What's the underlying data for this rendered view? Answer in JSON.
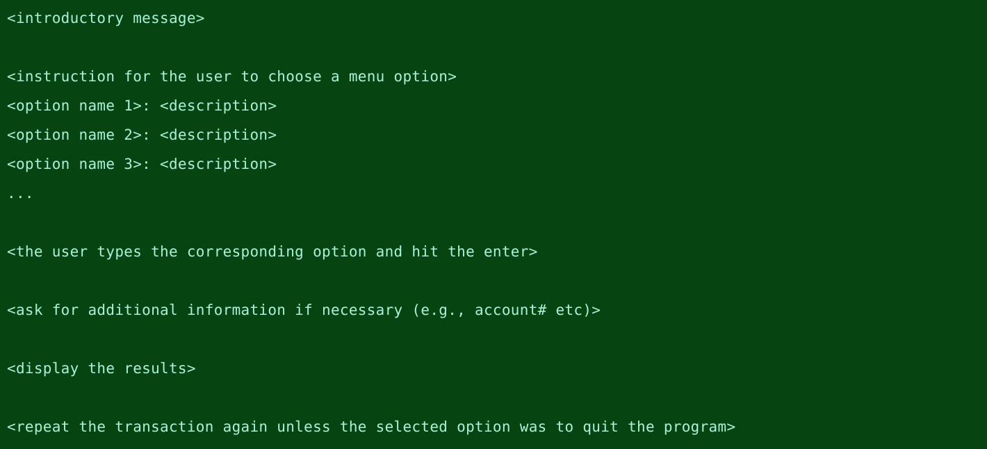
{
  "terminal": {
    "background_color": "#064512",
    "text_color": "#a9f0d6",
    "lines": [
      {
        "id": "intro",
        "text": "<introductory message>",
        "blank": false
      },
      {
        "id": "blank-1",
        "text": "",
        "blank": true
      },
      {
        "id": "menu-instruction",
        "text": "<instruction for the user to choose a menu option>",
        "blank": false
      },
      {
        "id": "option-1",
        "text": "<option name 1>: <description>",
        "blank": false
      },
      {
        "id": "option-2",
        "text": "<option name 2>: <description>",
        "blank": false
      },
      {
        "id": "option-3",
        "text": "<option name 3>: <description>",
        "blank": false
      },
      {
        "id": "ellipsis",
        "text": "...",
        "blank": false
      },
      {
        "id": "blank-2",
        "text": "",
        "blank": true
      },
      {
        "id": "user-input",
        "text": "<the user types the corresponding option and hit the enter>",
        "blank": false
      },
      {
        "id": "blank-3",
        "text": "",
        "blank": true
      },
      {
        "id": "additional-info",
        "text": "<ask for additional information if necessary (e.g., account# etc)>",
        "blank": false
      },
      {
        "id": "blank-4",
        "text": "",
        "blank": true
      },
      {
        "id": "display-results",
        "text": "<display the results>",
        "blank": false
      },
      {
        "id": "blank-5",
        "text": "",
        "blank": true
      },
      {
        "id": "repeat-transaction",
        "text": "<repeat the transaction again unless the selected option was to quit the program>",
        "blank": false
      }
    ]
  }
}
